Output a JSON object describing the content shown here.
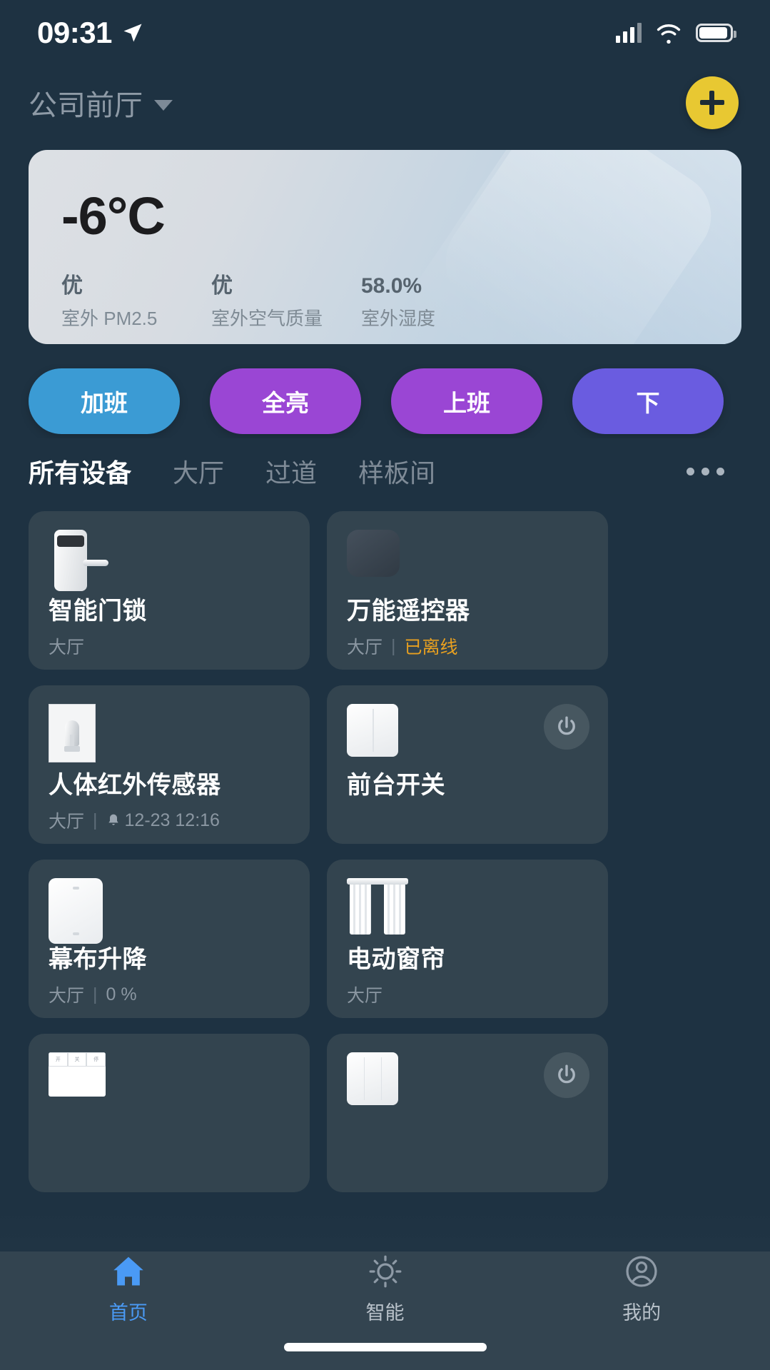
{
  "statusbar": {
    "time": "09:31",
    "location_icon": "location-arrow-icon",
    "signal_icon": "cellular-signal-icon",
    "wifi_icon": "wifi-icon",
    "battery_icon": "battery-icon"
  },
  "header": {
    "home_name": "公司前厅",
    "dropdown_icon": "chevron-down-icon",
    "add_icon": "plus-icon",
    "add_color": "#e8c832"
  },
  "weather": {
    "temperature": "-6°C",
    "metrics": [
      {
        "value": "优",
        "label": "室外 PM2.5"
      },
      {
        "value": "优",
        "label": "室外空气质量"
      },
      {
        "value": "58.0%",
        "label": "室外湿度"
      }
    ]
  },
  "scenes": [
    {
      "label": "加班",
      "color": "#3b9bd4"
    },
    {
      "label": "全亮",
      "color": "#9a46d4"
    },
    {
      "label": "上班",
      "color": "#9a46d4"
    },
    {
      "label": "下",
      "color": "#6a5ce0"
    }
  ],
  "tabs": {
    "items": [
      {
        "label": "所有设备",
        "active": true
      },
      {
        "label": "大厅",
        "active": false
      },
      {
        "label": "过道",
        "active": false
      },
      {
        "label": "样板间",
        "active": false
      }
    ],
    "more_icon": "more-horizontal-icon"
  },
  "devices": [
    {
      "name": "智能门锁",
      "room": "大厅",
      "status": "",
      "status_type": "none",
      "icon": "door-lock-icon",
      "power_button": false
    },
    {
      "name": "万能遥控器",
      "room": "大厅",
      "status": "已离线",
      "status_type": "offline",
      "icon": "universal-remote-icon",
      "power_button": false
    },
    {
      "name": "人体红外传感器",
      "room": "大厅",
      "status": "12-23 12:16",
      "status_type": "alert",
      "icon": "motion-sensor-icon",
      "power_button": false
    },
    {
      "name": "前台开关",
      "room": "",
      "status": "",
      "status_type": "none",
      "icon": "two-gang-switch-icon",
      "power_button": true
    },
    {
      "name": "幕布升降",
      "room": "大厅",
      "status": "0 %",
      "status_type": "value",
      "icon": "projector-screen-icon",
      "power_button": false
    },
    {
      "name": "电动窗帘",
      "room": "大厅",
      "status": "",
      "status_type": "none",
      "icon": "motorized-curtain-icon",
      "power_button": false
    },
    {
      "name": "",
      "room": "",
      "status": "",
      "status_type": "none",
      "icon": "control-panel-icon",
      "power_button": false
    },
    {
      "name": "",
      "room": "",
      "status": "",
      "status_type": "none",
      "icon": "three-gang-switch-icon",
      "power_button": true
    }
  ],
  "bottomnav": {
    "items": [
      {
        "label": "首页",
        "icon": "home-icon",
        "active": true
      },
      {
        "label": "智能",
        "icon": "sun-automation-icon",
        "active": false
      },
      {
        "label": "我的",
        "icon": "profile-icon",
        "active": false
      }
    ],
    "active_color": "#4a9af5"
  },
  "colors": {
    "background": "#1e3242",
    "card": "#33444f",
    "nav": "#334450",
    "offline_text": "#e8a020"
  }
}
